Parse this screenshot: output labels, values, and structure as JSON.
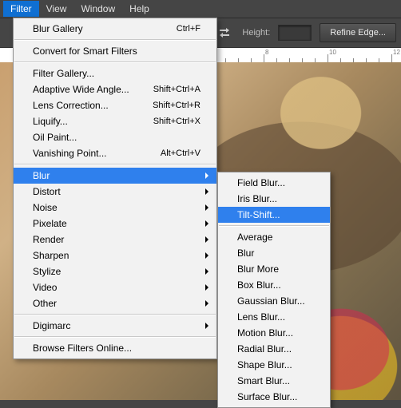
{
  "menubar": {
    "items": [
      "Filter",
      "View",
      "Window",
      "Help"
    ],
    "active_index": 0
  },
  "optionsbar": {
    "height_label": "Height:",
    "height_value": "",
    "refine_button": "Refine Edge..."
  },
  "ruler": {
    "labels": [
      "8",
      "10",
      "12"
    ]
  },
  "filter_menu": {
    "groups": [
      [
        {
          "label": "Blur Gallery",
          "shortcut": "Ctrl+F"
        }
      ],
      [
        {
          "label": "Convert for Smart Filters"
        }
      ],
      [
        {
          "label": "Filter Gallery..."
        },
        {
          "label": "Adaptive Wide Angle...",
          "shortcut": "Shift+Ctrl+A"
        },
        {
          "label": "Lens Correction...",
          "shortcut": "Shift+Ctrl+R"
        },
        {
          "label": "Liquify...",
          "shortcut": "Shift+Ctrl+X"
        },
        {
          "label": "Oil Paint..."
        },
        {
          "label": "Vanishing Point...",
          "shortcut": "Alt+Ctrl+V"
        }
      ],
      [
        {
          "label": "Blur",
          "submenu": true,
          "highlighted": true
        },
        {
          "label": "Distort",
          "submenu": true
        },
        {
          "label": "Noise",
          "submenu": true
        },
        {
          "label": "Pixelate",
          "submenu": true
        },
        {
          "label": "Render",
          "submenu": true
        },
        {
          "label": "Sharpen",
          "submenu": true
        },
        {
          "label": "Stylize",
          "submenu": true
        },
        {
          "label": "Video",
          "submenu": true
        },
        {
          "label": "Other",
          "submenu": true
        }
      ],
      [
        {
          "label": "Digimarc",
          "submenu": true
        }
      ],
      [
        {
          "label": "Browse Filters Online..."
        }
      ]
    ]
  },
  "blur_submenu": {
    "groups": [
      [
        {
          "label": "Field Blur..."
        },
        {
          "label": "Iris Blur..."
        },
        {
          "label": "Tilt-Shift...",
          "highlighted": true
        }
      ],
      [
        {
          "label": "Average"
        },
        {
          "label": "Blur"
        },
        {
          "label": "Blur More"
        },
        {
          "label": "Box Blur..."
        },
        {
          "label": "Gaussian Blur..."
        },
        {
          "label": "Lens Blur..."
        },
        {
          "label": "Motion Blur..."
        },
        {
          "label": "Radial Blur..."
        },
        {
          "label": "Shape Blur..."
        },
        {
          "label": "Smart Blur..."
        },
        {
          "label": "Surface Blur..."
        }
      ]
    ]
  }
}
